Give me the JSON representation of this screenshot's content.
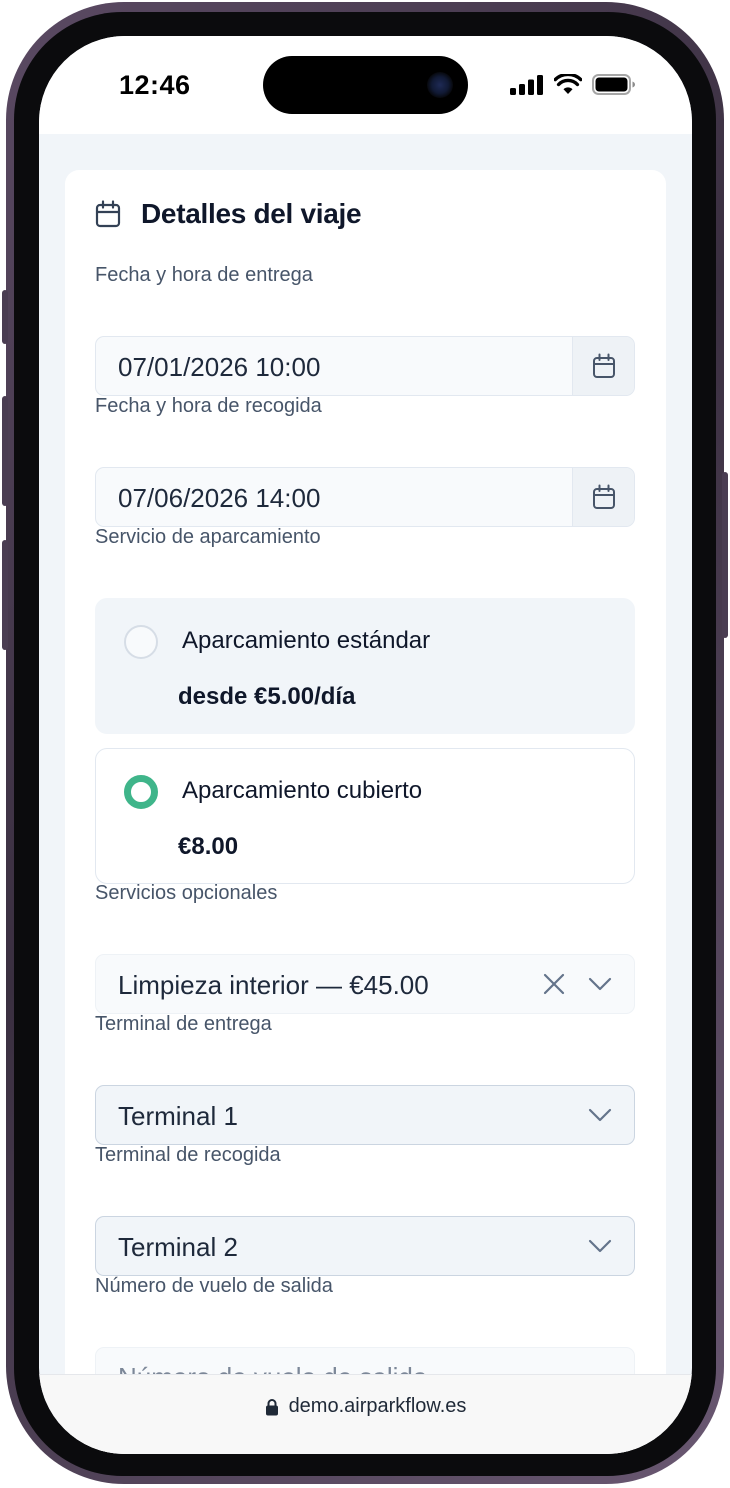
{
  "status_bar": {
    "time": "12:46"
  },
  "card": {
    "title": "Detalles del viaje",
    "dropoff": {
      "label": "Fecha y hora de entrega",
      "value": "07/01/2026 10:00"
    },
    "pickup": {
      "label": "Fecha y hora de recogida",
      "value": "07/06/2026 14:00"
    },
    "parking": {
      "label": "Servicio de aparcamiento",
      "options": [
        {
          "name": "Aparcamiento estándar",
          "price": "desde €5.00/día",
          "selected": false
        },
        {
          "name": "Aparcamiento cubierto",
          "price": "€8.00",
          "selected": true
        }
      ]
    },
    "optional": {
      "label": "Servicios opcionales",
      "value": "Limpieza interior — €45.00"
    },
    "dropoff_terminal": {
      "label": "Terminal de entrega",
      "value": "Terminal 1"
    },
    "pickup_terminal": {
      "label": "Terminal de recogida",
      "value": "Terminal 2"
    },
    "flight": {
      "label": "Número de vuelo de salida",
      "placeholder": "Número de vuelo de salida"
    }
  },
  "browser": {
    "url": "demo.airparkflow.es"
  },
  "colors": {
    "accent": "#3fb58a",
    "text": "#0f172a",
    "label": "#475569"
  }
}
